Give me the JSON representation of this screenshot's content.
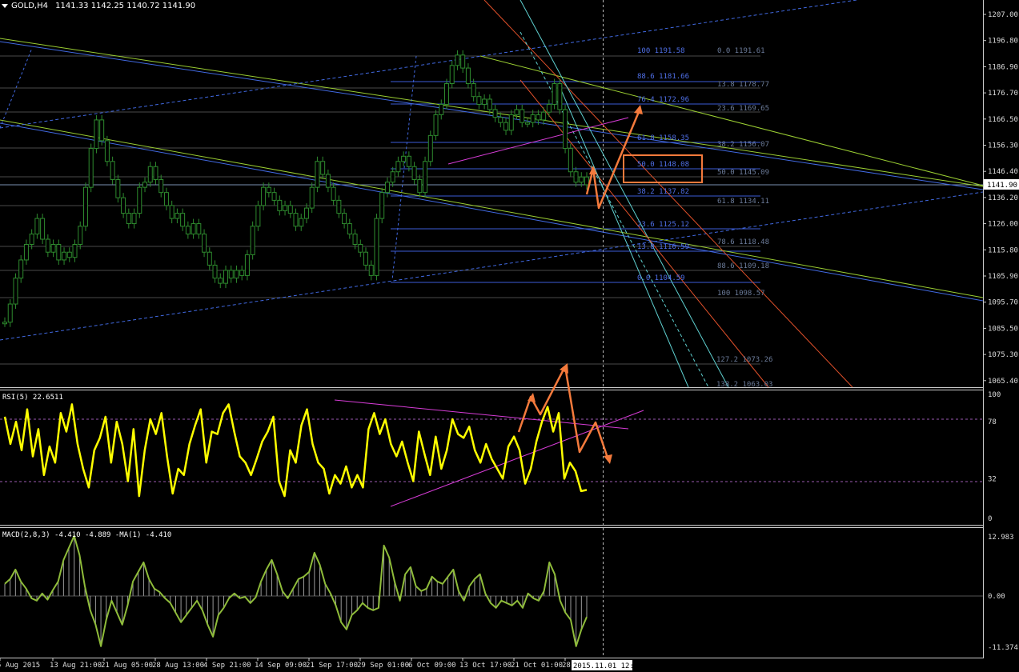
{
  "header": {
    "symbol": "GOLD,H4",
    "open": "1141.33",
    "high": "1142.25",
    "low": "1140.72",
    "close": "1141.90"
  },
  "price_axis": {
    "labels": [
      "1207.00",
      "1196.80",
      "1186.90",
      "1176.70",
      "1166.50",
      "1156.30",
      "1146.40",
      "1136.20",
      "1126.00",
      "1115.80",
      "1105.90",
      "1095.70",
      "1085.50",
      "1075.30",
      "1065.40"
    ],
    "current": "1141.90"
  },
  "rsi": {
    "title": "RSI(5) 22.6511",
    "levels": [
      "100",
      "78",
      "32",
      "0"
    ]
  },
  "macd": {
    "title": "MACD(2,8,3) -4.410 -4.889  -MA(1) -4.410",
    "levels": [
      "12.983",
      "0.00",
      "-11.374"
    ]
  },
  "time_axis": {
    "labels": [
      "5 Aug 2015",
      "13 Aug 21:00",
      "21 Aug 05:00",
      "28 Aug 13:00",
      "4 Sep 21:00",
      "14 Sep 09:00",
      "21 Sep 17:00",
      "29 Sep 01:00",
      "6 Oct 09:00",
      "13 Oct 17:00",
      "21 Oct 01:00",
      "28"
    ],
    "cursor_label": "2015.11.01 12:00"
  },
  "fibo_left": [
    "100 1191.58",
    "88.6 1181.66",
    "76.4 1172.96",
    "61.8 1158.35",
    "50.0 1148.08",
    "38.2 1137.82",
    "23.6 1125.12",
    "13.8 1116.59",
    "0.0 1104.59"
  ],
  "fibo_right": [
    "0.0 1191.61",
    "13.8 1178.77",
    "23.6 1169.65",
    "38.2 1156.07",
    "50.0 1145.09",
    "61.8 1134.11",
    "78.6 1118.48",
    "88.6 1109.18",
    "100 1098.57",
    "127.2 1073.26",
    "138.2 1063.03"
  ],
  "colors": {
    "background": "#000000",
    "candles": "#2e8b2e",
    "rsi_line": "#ffff00",
    "macd_line": "#8fbc3a",
    "annotation": "#f47a3c",
    "fibo": "#3b5bd6",
    "trend_magenta": "#d63cd6"
  },
  "chart_data": [
    {
      "type": "line",
      "title": "GOLD,H4",
      "ylim": [
        1065.4,
        1207.0
      ],
      "series": [
        {
          "name": "GOLD,H4",
          "values": [
            1088,
            1095,
            1105,
            1112,
            1118,
            1122,
            1128,
            1120,
            1115,
            1118,
            1112,
            1115,
            1113,
            1118,
            1125,
            1140,
            1155,
            1166,
            1158,
            1150,
            1143,
            1136,
            1130,
            1126,
            1130,
            1140,
            1142,
            1148,
            1143,
            1138,
            1133,
            1128,
            1130,
            1125,
            1122,
            1126,
            1122,
            1115,
            1110,
            1105,
            1103,
            1108,
            1105,
            1108,
            1106,
            1114,
            1125,
            1133,
            1140,
            1138,
            1135,
            1131,
            1133,
            1130,
            1125,
            1128,
            1132,
            1140,
            1150,
            1145,
            1140,
            1135,
            1130,
            1126,
            1122,
            1118,
            1115,
            1110,
            1106,
            1128,
            1138,
            1142,
            1146,
            1150,
            1152,
            1148,
            1143,
            1138,
            1150,
            1160,
            1168,
            1172,
            1180,
            1187,
            1191,
            1186,
            1180,
            1175,
            1172,
            1174,
            1170,
            1167,
            1165,
            1162,
            1168,
            1170,
            1165,
            1165,
            1168,
            1166,
            1169,
            1172,
            1180,
            1170,
            1155,
            1146,
            1142,
            1144,
            1141
          ]
        }
      ]
    },
    {
      "type": "line",
      "title": "RSI(5) 22.6511",
      "ylim": [
        0,
        100
      ],
      "series": [
        {
          "name": "RSI(5)",
          "values": [
            82,
            60,
            78,
            55,
            88,
            50,
            72,
            35,
            58,
            45,
            85,
            70,
            92,
            60,
            40,
            25,
            55,
            65,
            82,
            45,
            78,
            60,
            30,
            72,
            18,
            55,
            80,
            68,
            85,
            50,
            20,
            40,
            35,
            60,
            75,
            88,
            45,
            70,
            68,
            85,
            92,
            70,
            50,
            45,
            35,
            48,
            62,
            70,
            82,
            30,
            18,
            55,
            45,
            75,
            88,
            60,
            45,
            40,
            20,
            35,
            28,
            42,
            25,
            35,
            25,
            72,
            85,
            68,
            80,
            60,
            50,
            62,
            45,
            30,
            70,
            52,
            35,
            66,
            40,
            55,
            80,
            68,
            65,
            74,
            55,
            45,
            60,
            48,
            40,
            32,
            58,
            66,
            55,
            28,
            40,
            62,
            78,
            90,
            70,
            85,
            32,
            45,
            38,
            22,
            23
          ]
        }
      ]
    },
    {
      "type": "line",
      "title": "MACD(2,8,3) -4.410 -4.889  -MA(1) -4.410",
      "ylim": [
        -11.374,
        12.983
      ],
      "series": [
        {
          "name": "MACD(2,8,3)",
          "values": [
            2.5,
            3.5,
            5.5,
            3.0,
            1.5,
            -0.5,
            -1.0,
            0.5,
            -0.8,
            1.2,
            3.0,
            7.5,
            10.0,
            12.5,
            8.5,
            2.0,
            -3.0,
            -6.0,
            -10.5,
            -5.0,
            -1.0,
            -3.5,
            -6.0,
            -2.0,
            3.0,
            5.0,
            7.0,
            3.5,
            1.5,
            0.8,
            -0.5,
            -1.5,
            -3.5,
            -5.5,
            -4.0,
            -2.5,
            -1.0,
            -3.0,
            -6.0,
            -8.5,
            -4.0,
            -2.5,
            -0.5,
            0.5,
            -0.5,
            -0.2,
            -1.5,
            -0.3,
            3.0,
            5.5,
            7.5,
            4.5,
            1.0,
            -0.5,
            1.5,
            3.5,
            4.0,
            5.0,
            9.0,
            6.5,
            2.5,
            0.5,
            -2.0,
            -5.5,
            -7.0,
            -4.0,
            -3.0,
            -1.5,
            -2.5,
            -3.0,
            -2.5,
            10.5,
            8.0,
            3.0,
            -1.0,
            4.5,
            6.0,
            2.0,
            1.0,
            1.5,
            4.0,
            3.0,
            2.5,
            4.0,
            5.5,
            1.0,
            -1.0,
            2.0,
            3.5,
            4.5,
            0.5,
            -1.5,
            -2.5,
            -1.0,
            -1.5,
            -2.0,
            -1.0,
            -2.5,
            0.5,
            -0.5,
            -1.0,
            1.0,
            7.0,
            4.5,
            -1.0,
            -3.5,
            -5.0,
            -10.5,
            -7.0,
            -4.4
          ]
        }
      ]
    }
  ]
}
